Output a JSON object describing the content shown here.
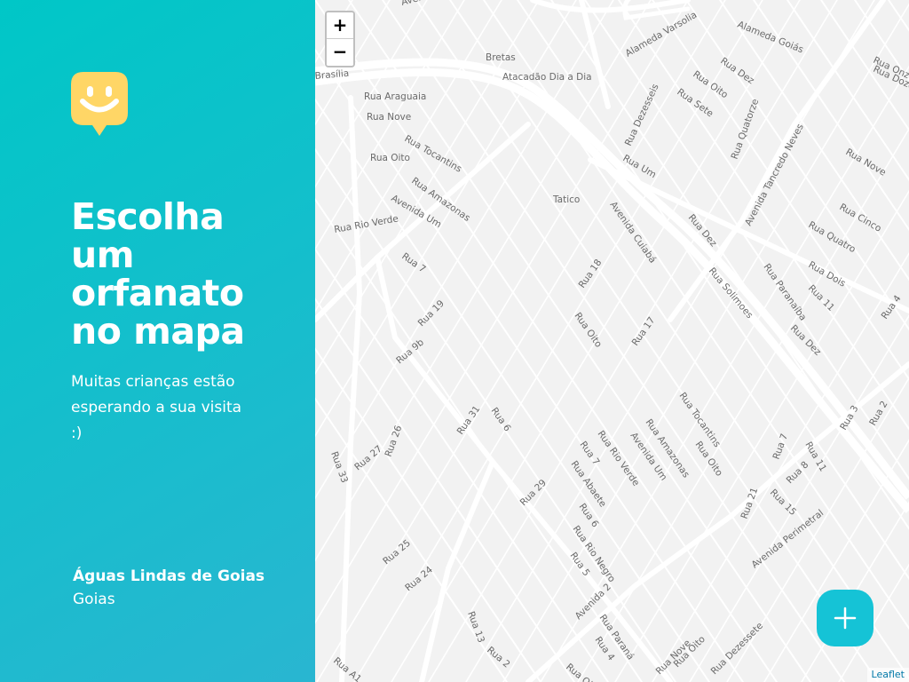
{
  "sidebar": {
    "logo_icon": "happy-face-marker",
    "headline": "Escolha um orfanato no mapa",
    "subtitle": "Muitas crianças estão esperando a sua visita :)",
    "location": {
      "city": "Águas Lindas de Goias",
      "state": "Goias"
    }
  },
  "map": {
    "zoom_in_label": "+",
    "zoom_out_label": "−",
    "attribution": "Leaflet",
    "add_button_icon": "plus-icon",
    "labels": [
      "Avenida",
      "Alameda Varsolia",
      "Alameda Goiás",
      "Rua Doze",
      "Rua Onze",
      "Bretas",
      "Atacadão Dia a Dia",
      "Brasília",
      "Rua Dez",
      "Rua Oito",
      "Rua Sete",
      "Rua Quatorze",
      "Rua Araguaia",
      "Rua Dezesseis",
      "Rua Nove",
      "Rua Tocantins",
      "Rua Oito",
      "Rua Um",
      "Avenida Tancredo Neves",
      "Rua Nove",
      "Tatico",
      "Rua Amazonas",
      "Avenida Um",
      "Avenida Cuiabá",
      "Rua Cinco",
      "Rua Rio Verde",
      "Rua Dez",
      "Rua Quatro",
      "Rua Dois",
      "Rua 7",
      "Rua 18",
      "Rua Solimoes",
      "Rua Paranaíba",
      "Rua 11",
      "Rua 4",
      "Rua 19",
      "Rua Oito",
      "Rua 17",
      "Rua Dez",
      "Rua 9b",
      "Rua Tocantins",
      "Rua Amazonas",
      "Avenida Um",
      "Rua Oito",
      "Rua 31",
      "Rua 6",
      "Rua Rio Verde",
      "Rua 3",
      "Rua 2",
      "Rua 26",
      "Rua 27",
      "Rua 33",
      "Rua 7",
      "Rua Abaete",
      "Rua 7",
      "Rua 11",
      "Rua 8",
      "Rua 29",
      "Rua 21",
      "Rua 15",
      "Rua 6",
      "Avenida Perimetral",
      "Rua Rio Negro",
      "Rua 25",
      "Rua 5",
      "Rua 24",
      "Avenida 2",
      "Rua Paraná",
      "Rua 13",
      "Rua 4",
      "Rua 2",
      "Rua A1",
      "Rua Oito",
      "Rua Dezessete",
      "Rua Nove",
      "Rua Oito"
    ]
  },
  "theme": {
    "accent": "#15c3d6",
    "sidebar_from": "#00c7c7",
    "sidebar_to": "#29b6d1",
    "logo": "#ffd666"
  }
}
